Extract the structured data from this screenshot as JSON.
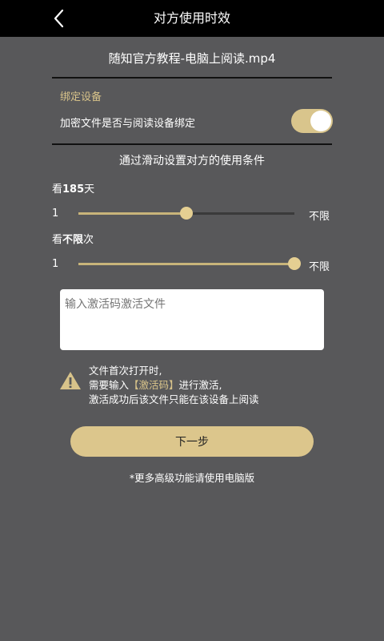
{
  "header": {
    "title": "对方使用时效",
    "back_icon": "chevron-left-icon"
  },
  "file": {
    "name": "随知官方教程-电脑上阅读.mp4"
  },
  "binding": {
    "section_label": "绑定设备",
    "label": "加密文件是否与阅读设备绑定",
    "enabled": true
  },
  "instruction": "通过滑动设置对方的使用条件",
  "conditions": {
    "days": {
      "prefix": "看",
      "value": "185",
      "suffix": "天",
      "min_label": "1",
      "max_label": "不限",
      "fraction": 0.5
    },
    "times": {
      "prefix": "看",
      "value": "不限",
      "suffix": "次",
      "min_label": "1",
      "max_label": "不限",
      "fraction": 1.0
    }
  },
  "activation": {
    "placeholder": "输入激活码激活文件"
  },
  "warning": {
    "icon": "warning-icon",
    "line1": "文件首次打开时,",
    "line2_prefix": "需要输入",
    "line2_code": "【激活码】",
    "line2_suffix": "进行激活,",
    "line3": "激活成功后该文件只能在该设备上阅读"
  },
  "next_button": "下一步",
  "footer_note": "*更多高级功能请使用电脑版",
  "colors": {
    "background": "#58585a",
    "header": "#000000",
    "accent": "#dcc68c"
  }
}
